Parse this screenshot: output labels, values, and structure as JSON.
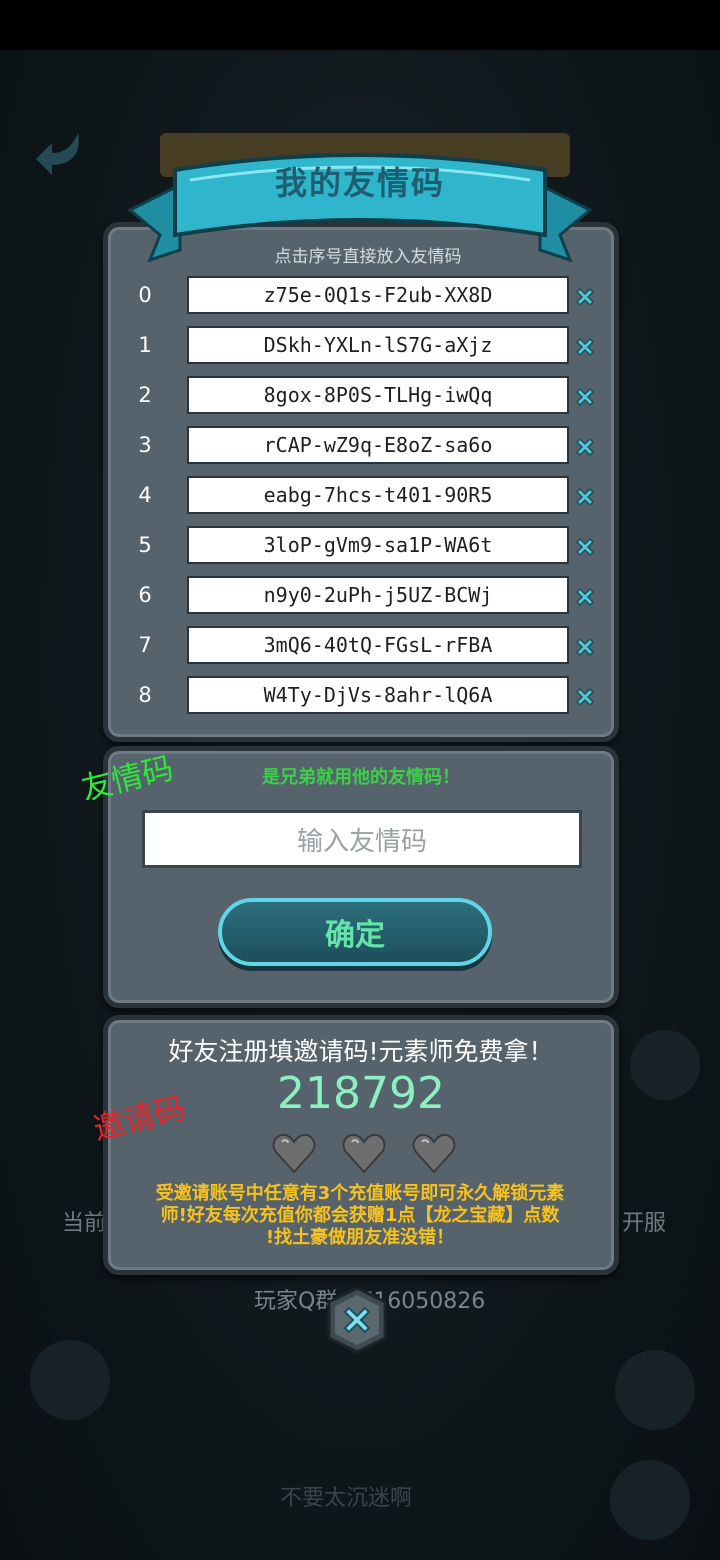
{
  "background": {
    "left_text": "当前",
    "right_text": "开服",
    "qq_group": "玩家Q群：716050826",
    "bottom_text": "不要太沉迷啊"
  },
  "dialog": {
    "title": "我的友情码",
    "hint": "点击序号直接放入友情码",
    "codes": [
      {
        "index": "0",
        "code": "z75e-0Q1s-F2ub-XX8D"
      },
      {
        "index": "1",
        "code": "DSkh-YXLn-lS7G-aXjz"
      },
      {
        "index": "2",
        "code": "8gox-8P0S-TLHg-iwQq"
      },
      {
        "index": "3",
        "code": "rCAP-wZ9q-E8oZ-sa6o"
      },
      {
        "index": "4",
        "code": "eabg-7hcs-t401-90R5"
      },
      {
        "index": "5",
        "code": "3loP-gVm9-sa1P-WA6t"
      },
      {
        "index": "6",
        "code": "n9y0-2uPh-j5UZ-BCWj"
      },
      {
        "index": "7",
        "code": "3mQ6-40tQ-FGsL-rFBA"
      },
      {
        "index": "8",
        "code": "W4Ty-DjVs-8ahr-lQ6A"
      }
    ],
    "delete_icon": "close-x-icon"
  },
  "friend_input": {
    "label": "是兄弟就用他的友情码！",
    "placeholder": "输入友情码",
    "confirm_label": "确定"
  },
  "annotations": {
    "friend_code": "友情码",
    "invite_code": "邀请码"
  },
  "invite": {
    "title": "好友注册填邀请码!元素师免费拿！",
    "code": "218792",
    "hearts": [
      "heart-empty",
      "heart-empty",
      "heart-empty"
    ],
    "desc_line1": "受邀请账号中任意有3个充值账号即可永久解锁元素",
    "desc_line2": "师!好友每次充值你都会获赠1点【龙之宝藏】点数",
    "desc_line3": "!找土豪做朋友准没错！"
  },
  "colors": {
    "panel": "#57636c",
    "banner": "#2fb6cc",
    "accent_green": "#39d147",
    "code_green": "#8cf0c2",
    "desc_yellow": "#f7c21b",
    "annotation_red": "#e8242a"
  }
}
